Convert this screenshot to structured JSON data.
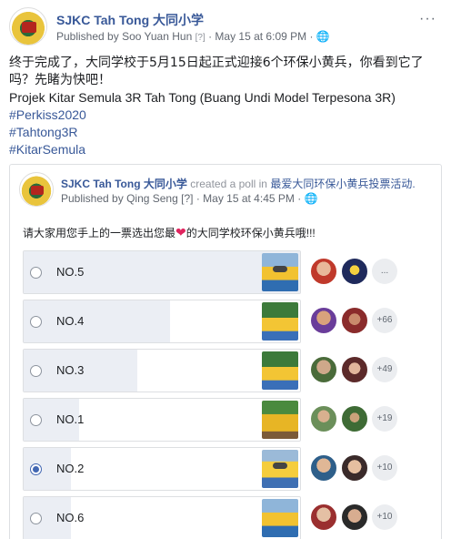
{
  "post": {
    "page_name": "SJKC Tah Tong 大同小学",
    "published_prefix": "Published by",
    "author": "Soo Yuan Hun",
    "q_mark": "[?]",
    "date": "May 15 at 6:09 PM",
    "separator": "·",
    "more_glyph": "···",
    "text_line1": "终于完成了，大同学校于5月15日起正式迎接6个环保小黄兵，你看到它了吗？先睹为快吧！",
    "text_line2": "Projek Kitar Semula 3R Tah Tong (Buang Undi Model Terpesona 3R)",
    "hashtags": [
      "#Perkiss2020",
      "#Tahtong3R",
      "#KitarSemula"
    ]
  },
  "share": {
    "page_name": "SJKC Tah Tong 大同小学",
    "action": "created a poll in",
    "event": "最爱大同环保小黄兵投票活动.",
    "published_prefix": "Published by",
    "author": "Qing Seng",
    "q_mark": "[?]",
    "date": "May 15 at 4:45 PM",
    "separator": "·"
  },
  "poll": {
    "question_pre": "请大家用您手上的一票选出您最",
    "heart_glyph": "❤",
    "question_post": "的大同学校环保小黄兵哦!!!",
    "options": [
      {
        "label": "NO.5",
        "fill": 1.0,
        "more": "..."
      },
      {
        "label": "NO.4",
        "fill": 0.53,
        "more": "+66"
      },
      {
        "label": "NO.3",
        "fill": 0.41,
        "more": "+49"
      },
      {
        "label": "NO.1",
        "fill": 0.2,
        "more": "+19"
      },
      {
        "label": "NO.2",
        "fill": 0.17,
        "more": "+10",
        "checked": true
      },
      {
        "label": "NO.6",
        "fill": 0.17,
        "more": "+10"
      }
    ]
  },
  "colors": {
    "link": "#385898",
    "radio_checked": "#4267b2",
    "bar_fill": "#ebeef4",
    "heart": "#e0245e"
  }
}
